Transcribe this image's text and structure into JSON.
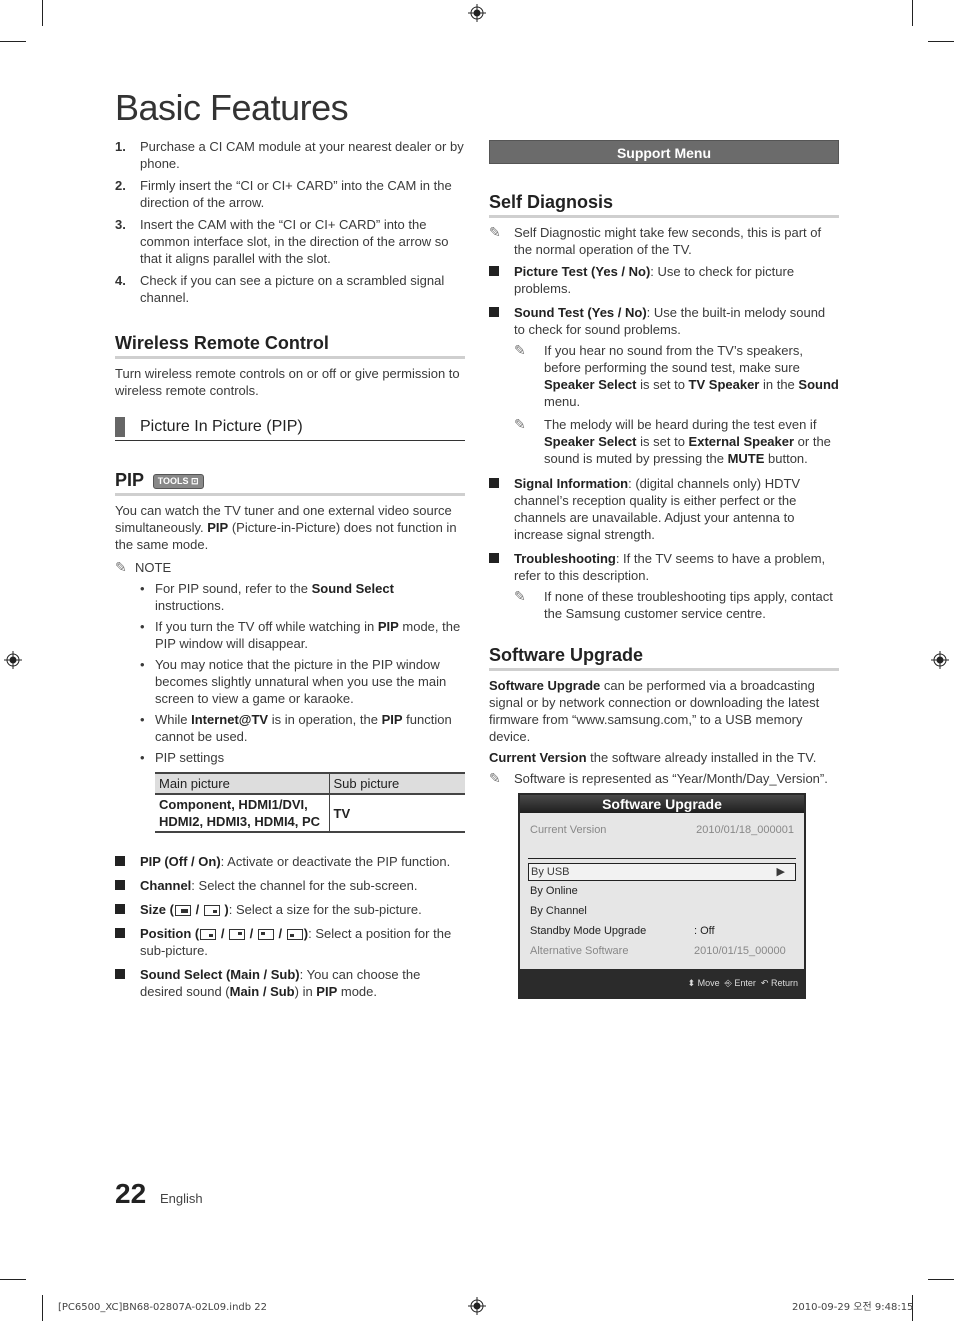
{
  "page": {
    "title": "Basic Features",
    "page_number": "22",
    "language": "English",
    "slug_file": "[PC6500_XC]BN68-02807A-02L09.indb   22",
    "slug_date": "2010-09-29   오전 9:48:15"
  },
  "left": {
    "steps": [
      {
        "n": "1.",
        "text": "Purchase a CI CAM module at your nearest dealer or by phone."
      },
      {
        "n": "2.",
        "text": "Firmly insert the “CI or CI+ CARD” into the CAM in the direction of the arrow."
      },
      {
        "n": "3.",
        "text": "Insert the CAM with the “CI or CI+ CARD” into the common interface slot, in the direction of the arrow so that it aligns parallel with the slot."
      },
      {
        "n": "4.",
        "text": "Check if you can see a picture on a scrambled signal channel."
      }
    ],
    "wireless": {
      "heading": "Wireless Remote Control",
      "text": "Turn wireless remote controls on or off or give permission to wireless remote controls."
    },
    "pip_section": "Picture In Picture (PIP)",
    "pip": {
      "heading": "PIP",
      "tools_badge": "TOOLS",
      "intro_a": "You can watch the TV tuner and one external video source simultaneously. ",
      "intro_b": "PIP",
      "intro_c": " (Picture-in-Picture) does not function in the same mode.",
      "note_label": "NOTE",
      "notes": {
        "n1a": "For PIP sound, refer to the ",
        "n1b": "Sound Select",
        "n1c": " instructions.",
        "n2a": "If you turn the TV off while watching in ",
        "n2b": "PIP",
        "n2c": " mode, the PIP window will disappear.",
        "n3": "You may notice that the picture in the PIP window becomes slightly unnatural when you use the main screen to view a game or karaoke.",
        "n4a": "While ",
        "n4b": "Internet@TV",
        "n4c": " is in operation, the ",
        "n4d": "PIP",
        "n4e": " function cannot be used.",
        "n5": "PIP settings"
      },
      "table": {
        "headers": [
          "Main picture",
          "Sub picture"
        ],
        "main": "Component, HDMI1/DVI, HDMI2, HDMI3, HDMI4, PC",
        "sub": "TV"
      },
      "options": {
        "o1a": "PIP (Off / On)",
        "o1b": ": Activate or deactivate the PIP function.",
        "o2a": "Channel",
        "o2b": ": Select the channel for the sub-screen.",
        "o3a": "Size (",
        "o3b": " / ",
        "o3c": " )",
        "o3d": ": Select a size for the sub-picture.",
        "o4a": "Position (",
        "o4sep": " / ",
        "o4c": ")",
        "o4d": ": Select a position for the sub-picture.",
        "o5a": "Sound Select (Main / Sub)",
        "o5b": ": You can choose the desired sound (",
        "o5c": "Main / Sub",
        "o5d": ") in ",
        "o5e": "PIP",
        "o5f": " mode."
      }
    }
  },
  "right": {
    "support_bar": "Support Menu",
    "self_diag": {
      "heading": "Self Diagnosis",
      "note": "Self Diagnostic might take few seconds, this is part of the normal operation of the TV.",
      "i1a": "Picture Test (Yes / No)",
      "i1b": ": Use to check for picture problems.",
      "i2a": "Sound Test (Yes / No)",
      "i2b": ": Use the built-in melody sound to check for sound problems.",
      "s1a": "If you hear no sound from the TV’s speakers, before performing the sound test, make sure ",
      "s1b": "Speaker Select",
      "s1c": " is set to ",
      "s1d": "TV Speaker",
      "s1e": " in the ",
      "s1f": "Sound",
      "s1g": " menu.",
      "s2a": "The melody will be heard during the test even if ",
      "s2b": "Speaker Select",
      "s2c": " is set to ",
      "s2d": "External Speaker",
      "s2e": " or the sound is muted by pressing the ",
      "s2f": "MUTE",
      "s2g": " button.",
      "i3a": "Signal Information",
      "i3b": ": (digital channels only) HDTV channel’s reception quality is either perfect or the channels are unavailable. Adjust your antenna to increase signal strength.",
      "i4a": "Troubleshooting",
      "i4b": ": If the TV seems to have a problem, refer to this description.",
      "s3": "If none of these troubleshooting tips apply, contact the Samsung customer service centre."
    },
    "sw": {
      "heading": "Software Upgrade",
      "p1a": "Software Upgrade",
      "p1b": " can be performed via a broadcasting signal or by network connection or downloading the latest firmware from “www.samsung.com,” to a USB memory device.",
      "p2a": "Current Version",
      "p2b": " the software already installed in the TV.",
      "note": "Software is represented as “Year/Month/Day_Version”."
    },
    "tv": {
      "title": "Software Upgrade",
      "current_label": "Current Version",
      "current_value": "2010/01/18_000001",
      "selected": "By USB",
      "items": [
        "By Online",
        "By Channel"
      ],
      "standby_label": "Standby Mode Upgrade",
      "standby_value": ": Off",
      "alt_label": "Alternative Software",
      "alt_value": "2010/01/15_00000",
      "foot_move": "Move",
      "foot_enter": "Enter",
      "foot_return": "Return"
    }
  }
}
